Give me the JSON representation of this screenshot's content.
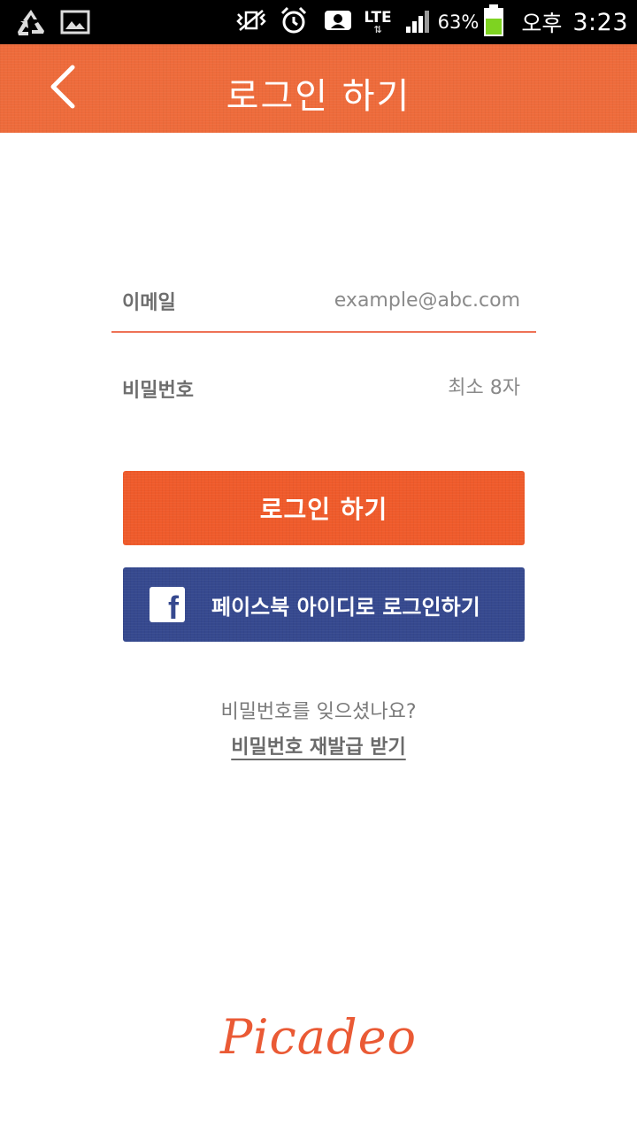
{
  "status_bar": {
    "network": "LTE",
    "battery_percent": "63%",
    "ampm": "오후",
    "time": "3:23",
    "battery_level": 0.63
  },
  "header": {
    "title": "로그인 하기"
  },
  "form": {
    "email_label": "이메일",
    "email_placeholder": "example@abc.com",
    "password_label": "비밀번호",
    "password_placeholder": "최소 8자"
  },
  "buttons": {
    "login_label": "로그인 하기",
    "facebook_label": "페이스북 아이디로 로그인하기"
  },
  "forgot": {
    "question": "비밀번호를 잊으셨나요?",
    "reset_link": "비밀번호 재발급 받기"
  },
  "brand": {
    "logo_text": "Picadeo"
  },
  "colors": {
    "accent": "#ee6b3b",
    "facebook": "#36498f",
    "input_underline": "#ee7256"
  }
}
